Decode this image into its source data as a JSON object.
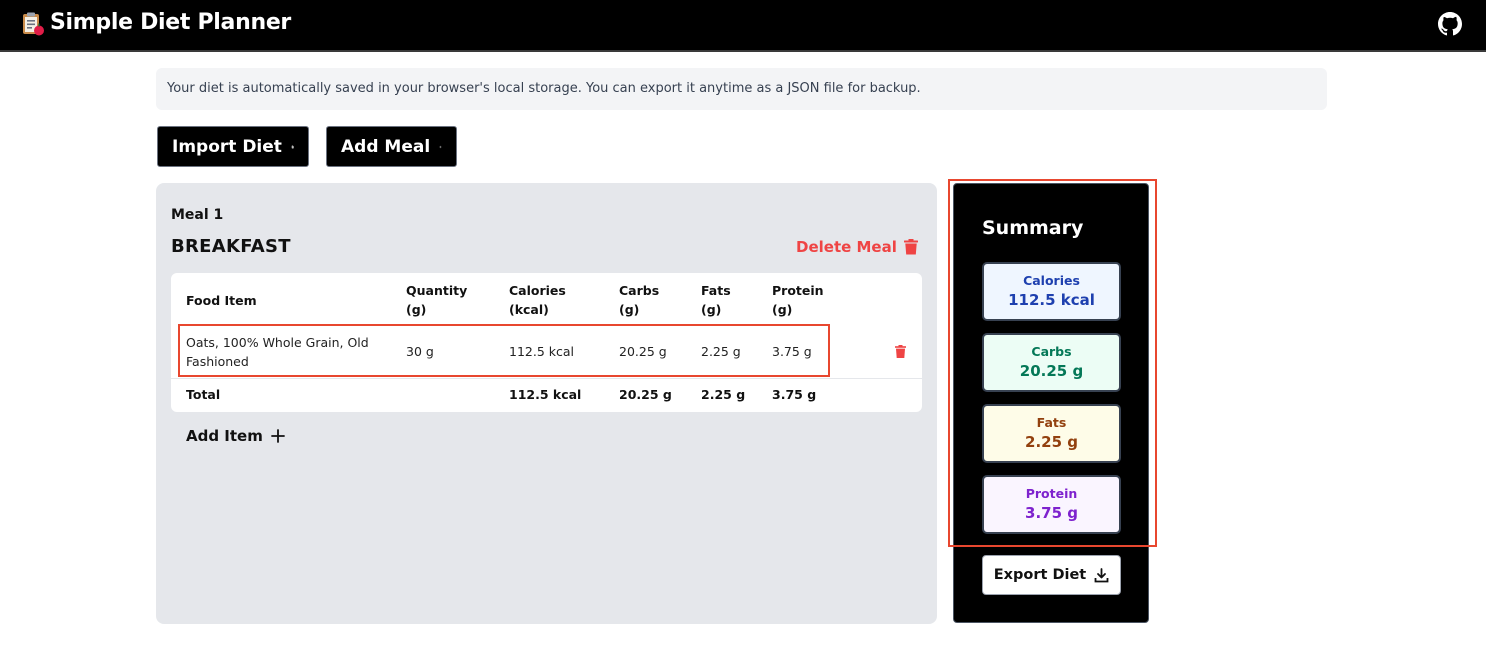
{
  "header": {
    "title": "Simple Diet Planner",
    "logo_icon": "clipboard-apple-icon",
    "github_icon": "github-icon"
  },
  "info_banner": "Your diet is automatically saved in your browser's local storage. You can export it anytime as a JSON file for backup.",
  "toolbar": {
    "import_label": "Import Diet",
    "add_meal_label": "Add Meal"
  },
  "meal": {
    "number_label": "Meal 1",
    "name": "BREAKFAST",
    "delete_label": "Delete Meal",
    "columns": {
      "food": "Food Item",
      "quantity": [
        "Quantity",
        "(g)"
      ],
      "calories": [
        "Calories",
        "(kcal)"
      ],
      "carbs": [
        "Carbs",
        "(g)"
      ],
      "fats": [
        "Fats",
        "(g)"
      ],
      "protein": [
        "Protein",
        "(g)"
      ]
    },
    "items": [
      {
        "food": [
          "Oats, 100% Whole Grain, Old",
          "Fashioned"
        ],
        "quantity": "30 g",
        "calories": "112.5 kcal",
        "carbs": "20.25 g",
        "fats": "2.25 g",
        "protein": "3.75 g"
      }
    ],
    "total": {
      "label": "Total",
      "calories": "112.5 kcal",
      "carbs": "20.25 g",
      "fats": "2.25 g",
      "protein": "3.75 g"
    },
    "add_item_label": "Add Item"
  },
  "summary": {
    "title": "Summary",
    "calories": {
      "label": "Calories",
      "value": "112.5 kcal",
      "bg": "#eff6ff",
      "color": "#1e40af"
    },
    "carbs": {
      "label": "Carbs",
      "value": "20.25 g",
      "bg": "#ecfdf5",
      "color": "#047857"
    },
    "fats": {
      "label": "Fats",
      "value": "2.25 g",
      "bg": "#fefce8",
      "color": "#92400e"
    },
    "protein": {
      "label": "Protein",
      "value": "3.75 g",
      "bg": "#faf5ff",
      "color": "#7e22ce"
    },
    "export_label": "Export Diet"
  },
  "colors": {
    "accent_red": "#ef4444",
    "highlight": "#e8472f",
    "topbar": "#000000",
    "card_bg": "#e5e7eb"
  }
}
